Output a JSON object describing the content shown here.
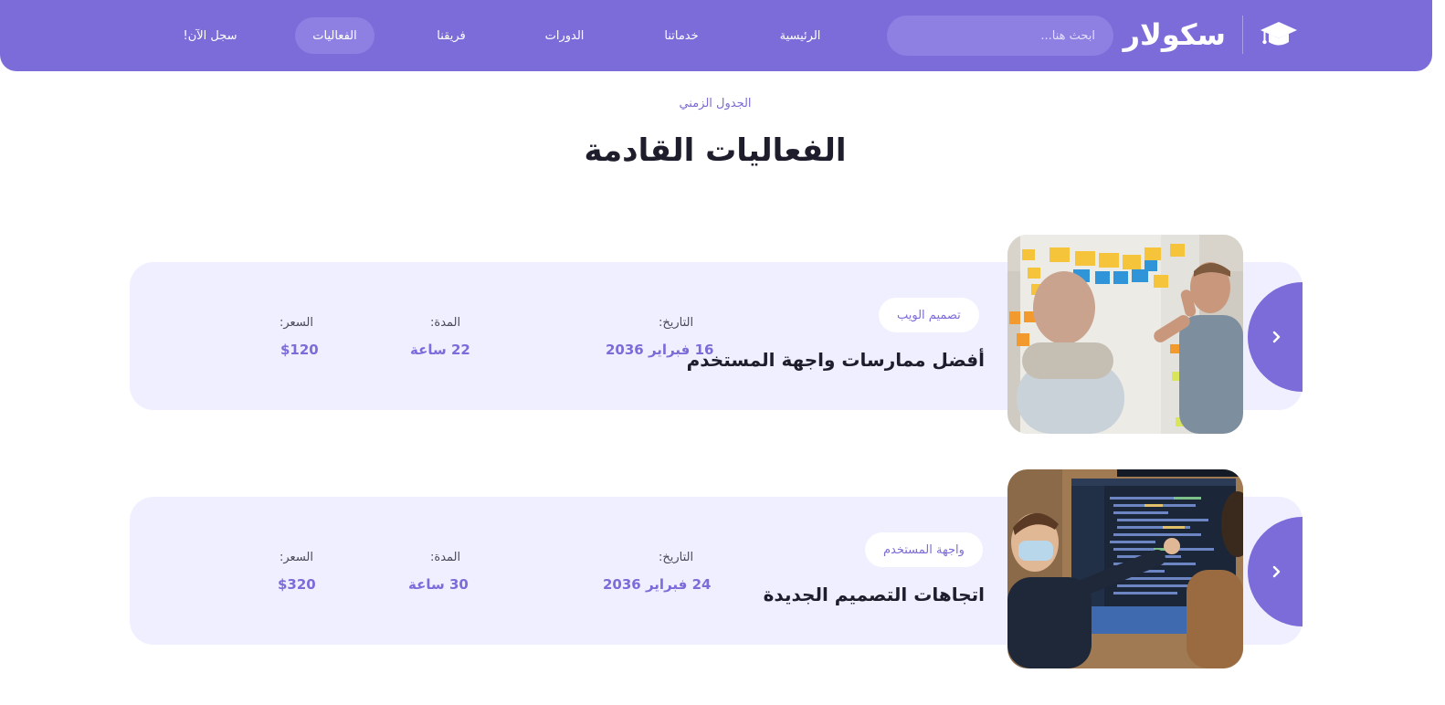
{
  "header": {
    "brand": "سكولار",
    "search_placeholder": "ابحث هنا...",
    "nav": [
      {
        "label": "الرئيسية",
        "active": false
      },
      {
        "label": "خدماتنا",
        "active": false
      },
      {
        "label": "الدورات",
        "active": false
      },
      {
        "label": "فريقنا",
        "active": false
      },
      {
        "label": "الفعاليات",
        "active": true
      },
      {
        "label": "سجل الآن!",
        "active": false
      }
    ]
  },
  "section": {
    "eyebrow": "الجدول الزمني",
    "title": "الفعاليات القادمة"
  },
  "events": [
    {
      "tag": "تصميم الويب",
      "title": "أفضل ممارسات واجهة المستخدم",
      "date_label": "التاريخ:",
      "date": "16 فبراير 2036",
      "duration_label": "المدة:",
      "duration": "22 ساعة",
      "price_label": "السعر:",
      "price": "$120"
    },
    {
      "tag": "واجهة المستخدم",
      "title": "اتجاهات التصميم الجديدة",
      "date_label": "التاريخ:",
      "date": "24 فبراير 2036",
      "duration_label": "المدة:",
      "duration": "30 ساعة",
      "price_label": "السعر:",
      "price": "$320"
    }
  ],
  "colors": {
    "accent": "#7b6cd9",
    "card_background": "#f0efff",
    "title_text": "#1d1d2c"
  },
  "icons": {
    "logo": "graduation-cap-icon",
    "card_arrow": "chevron-right-icon"
  }
}
